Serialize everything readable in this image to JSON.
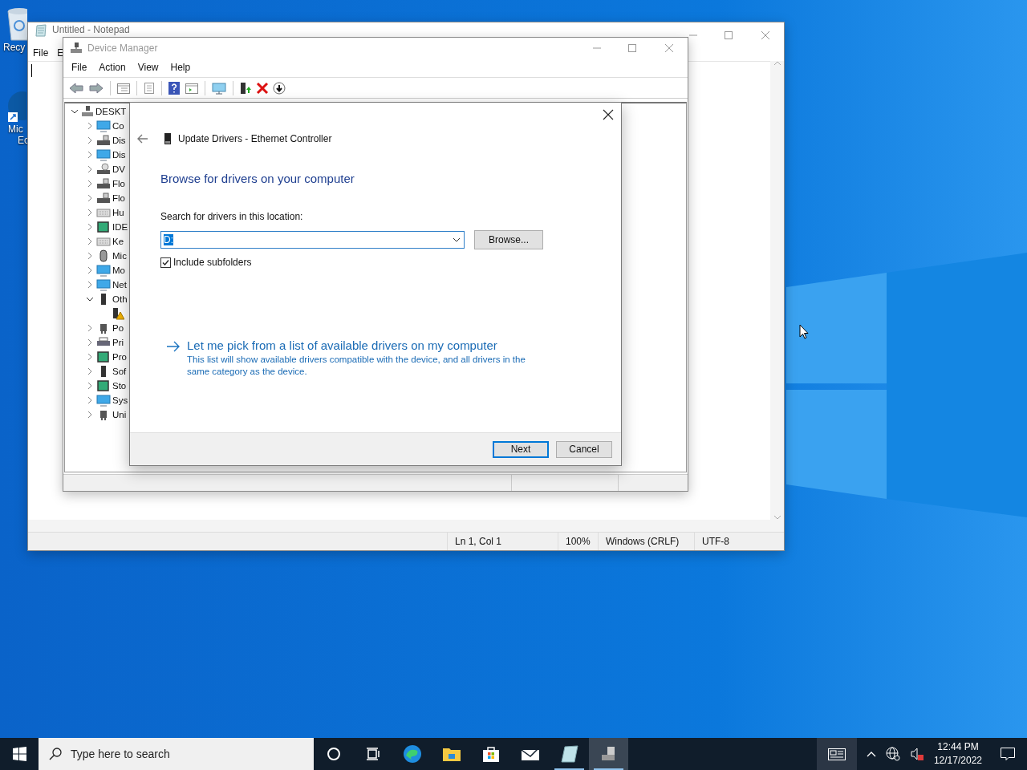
{
  "desktop": {
    "icons": [
      {
        "lines": [
          "Recy"
        ]
      },
      {
        "lines": [
          "Mic",
          "Ec"
        ]
      }
    ]
  },
  "notepad": {
    "title": "Untitled - Notepad",
    "menu": [
      "File",
      "E"
    ],
    "status_bar": [
      "Ln 1, Col 1",
      "100%",
      "Windows (CRLF)",
      "UTF-8"
    ]
  },
  "device_manager": {
    "title": "Device Manager",
    "menu": [
      "File",
      "Action",
      "View",
      "Help"
    ],
    "tree": {
      "label": "DESKT",
      "expanded": true,
      "children": [
        {
          "label": "Co",
          "expanded": false
        },
        {
          "label": "Dis",
          "expanded": false
        },
        {
          "label": "Dis",
          "expanded": false
        },
        {
          "label": "DV",
          "expanded": false
        },
        {
          "label": "Flo",
          "expanded": false
        },
        {
          "label": "Flo",
          "expanded": false
        },
        {
          "label": "Hu",
          "expanded": false
        },
        {
          "label": "IDE",
          "expanded": false
        },
        {
          "label": "Ke",
          "expanded": false
        },
        {
          "label": "Mic",
          "expanded": false
        },
        {
          "label": "Mo",
          "expanded": false
        },
        {
          "label": "Net",
          "expanded": false
        },
        {
          "label": "Oth",
          "expanded": true,
          "children": [
            {
              "warning": true
            }
          ]
        },
        {
          "label": "Po",
          "expanded": false
        },
        {
          "label": "Pri",
          "expanded": false
        },
        {
          "label": "Pro",
          "expanded": false
        },
        {
          "label": "Sof",
          "expanded": false
        },
        {
          "label": "Sto",
          "expanded": false
        },
        {
          "label": "Sys",
          "expanded": false
        },
        {
          "label": "Uni",
          "expanded": false
        }
      ]
    }
  },
  "dialog": {
    "title": "Update Drivers - Ethernet Controller",
    "heading": "Browse for drivers on your computer",
    "location_label": "Search for drivers in this location:",
    "location_value": "D:",
    "browse_button": "Browse...",
    "include_subfolders": {
      "label": "Include subfolders",
      "checked": true
    },
    "pick_link": {
      "title": "Let me pick from a list of available drivers on my computer",
      "description": "This list will show available drivers compatible with the device, and all drivers in the same category as the device."
    },
    "buttons": [
      {
        "label": "Next",
        "default": true
      },
      {
        "label": "Cancel",
        "default": false
      }
    ]
  },
  "taskbar": {
    "search_placeholder": "Type here to search",
    "apps": [
      {
        "kind": "circle",
        "running": false,
        "selected": false
      },
      {
        "kind": "taskview",
        "running": false,
        "selected": false
      },
      {
        "kind": "browser",
        "running": false,
        "selected": false
      },
      {
        "kind": "folder",
        "running": false,
        "selected": false
      },
      {
        "kind": "store",
        "running": false,
        "selected": false
      },
      {
        "kind": "mail",
        "running": false,
        "selected": false
      },
      {
        "kind": "notepad",
        "running": true,
        "selected": false
      },
      {
        "kind": "devices",
        "running": true,
        "selected": true
      }
    ],
    "time": "12:44 PM",
    "date": "12/17/2022"
  }
}
